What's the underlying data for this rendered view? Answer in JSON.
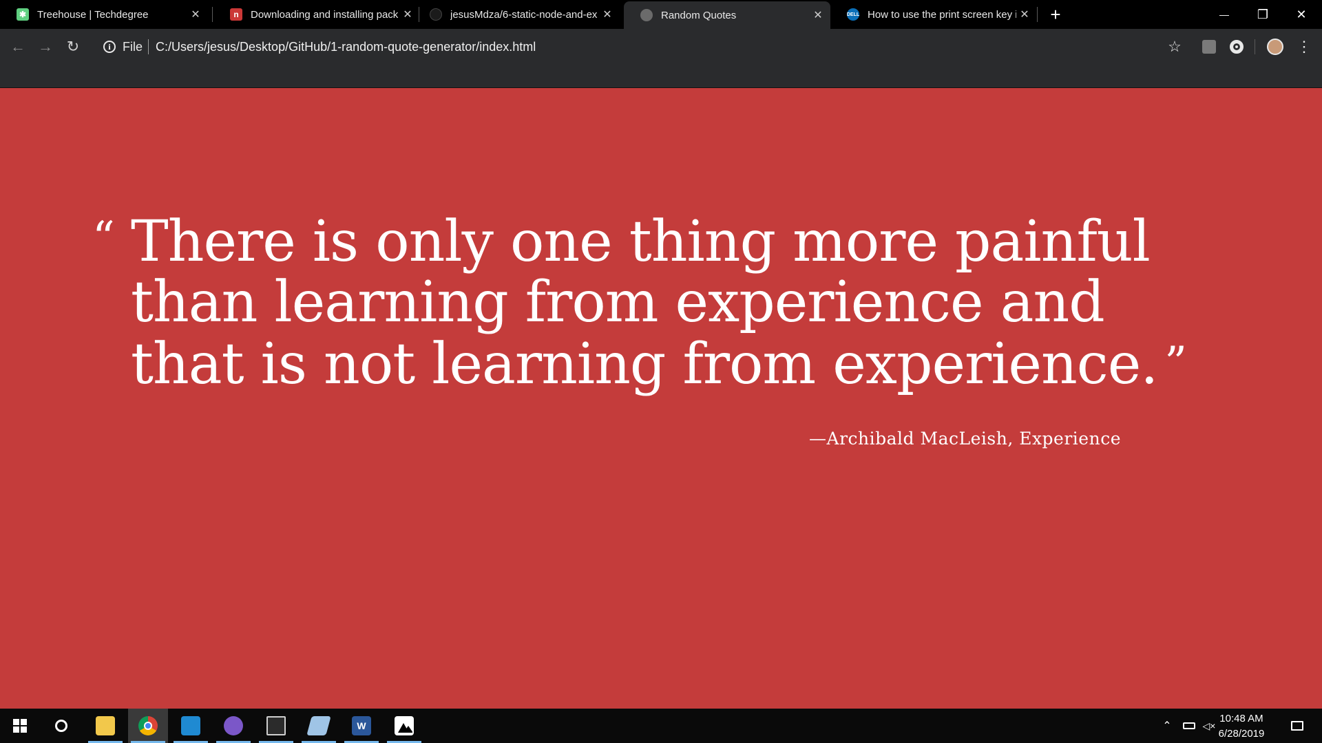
{
  "browser": {
    "tabs": [
      {
        "title": "Treehouse | Techdegree",
        "favicon": "treehouse-icon",
        "favicon_color": "#5fcf80",
        "active": false
      },
      {
        "title": "Downloading and installing pack",
        "favicon": "npm-icon",
        "favicon_color": "#cb3837",
        "active": false
      },
      {
        "title": "jesusMdza/6-static-node-and-ex",
        "favicon": "github-icon",
        "favicon_color": "#1b1b1b",
        "active": false
      },
      {
        "title": "Random Quotes",
        "favicon": "globe-icon",
        "favicon_color": "#6b6b6b",
        "active": true
      },
      {
        "title": "How to use the print screen key i",
        "favicon": "dell-icon",
        "favicon_color": "#0b6fb8",
        "active": false
      }
    ],
    "address": {
      "scheme_label": "File",
      "url": "C:/Users/jesus/Desktop/GitHub/1-random-quote-generator/index.html"
    },
    "glyphs": {
      "close": "✕",
      "new_tab": "+",
      "minimize": "—",
      "restore": "❐",
      "window_close": "✕",
      "back": "←",
      "forward": "→",
      "reload": "↻",
      "info": "i",
      "star": "☆",
      "menu": "⋮"
    }
  },
  "page": {
    "background_color": "#c43c3b",
    "quote": {
      "open_mark": "“",
      "text": "There is only one thing more painful than learning from experience and that is not learning from experience.",
      "close_mark": "”"
    },
    "source": "—Archibald MacLeish, Experience"
  },
  "taskbar": {
    "apps": [
      {
        "name": "file-explorer-icon",
        "color": "#f2c84b",
        "active": false
      },
      {
        "name": "chrome-icon",
        "color": "#4285f4",
        "active": true
      },
      {
        "name": "vscode-icon",
        "color": "#1f8ad2",
        "active": false
      },
      {
        "name": "github-desktop-icon",
        "color": "#7b57c8",
        "active": false
      },
      {
        "name": "terminal-icon",
        "color": "#2b2b2b",
        "active": false
      },
      {
        "name": "notes-icon",
        "color": "#9fc4e6",
        "active": false
      },
      {
        "name": "word-icon",
        "color": "#2b579a",
        "active": false,
        "label": "W"
      },
      {
        "name": "photos-icon",
        "color": "#ffffff",
        "active": false
      }
    ],
    "clock": {
      "time": "10:48 AM",
      "date": "6/28/2019"
    }
  }
}
